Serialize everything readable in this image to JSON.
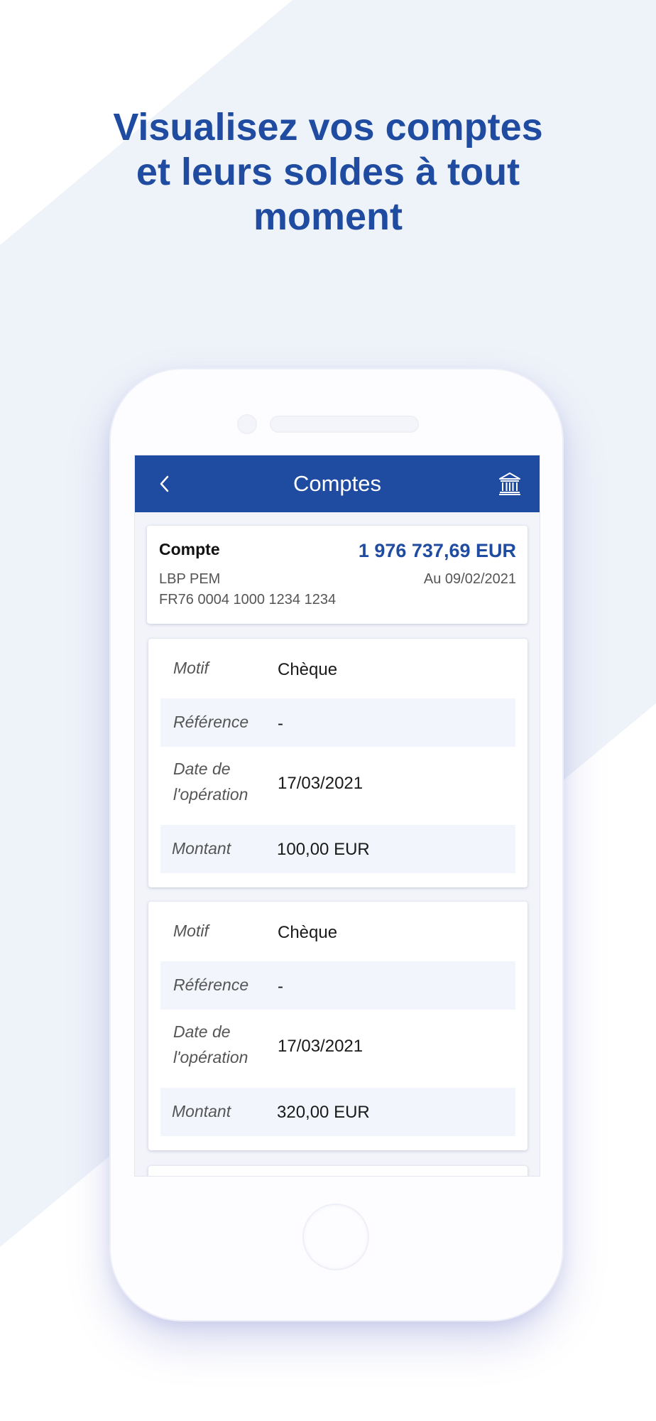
{
  "headline": {
    "line1": "Visualisez vos comptes",
    "line2": "et leurs soldes à tout",
    "line3": "moment"
  },
  "colors": {
    "brand": "#1f4ba0",
    "band": "#eef2f9",
    "row_alt": "#f2f5fb"
  },
  "appbar": {
    "title": "Comptes",
    "back_icon": "chevron-left-icon",
    "bank_icon": "bank-icon"
  },
  "account": {
    "name": "Compte",
    "balance": "1 976 737,69 EUR",
    "label": "LBP PEM",
    "date": "Au 09/02/2021",
    "iban": "FR76 0004 1000 1234 1234"
  },
  "operations": [
    {
      "motif_key": "Motif",
      "motif": "Chèque",
      "reference_key": "Référence",
      "reference": "-",
      "date_key_line1": "Date de",
      "date_key_line2": "l'opération",
      "date": "17/03/2021",
      "amount_key": "Montant",
      "amount": "100,00 EUR"
    },
    {
      "motif_key": "Motif",
      "motif": "Chèque",
      "reference_key": "Référence",
      "reference": "-",
      "date_key_line1": "Date de",
      "date_key_line2": "l'opération",
      "date": "17/03/2021",
      "amount_key": "Montant",
      "amount": "320,00 EUR"
    }
  ]
}
